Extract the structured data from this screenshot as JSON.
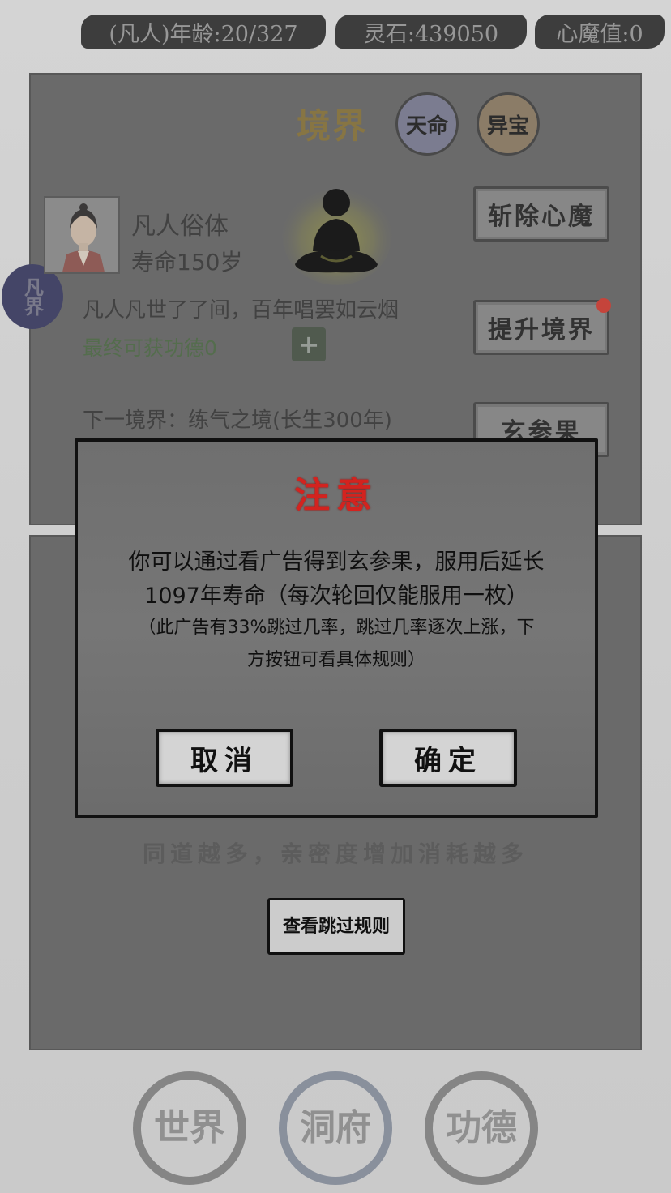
{
  "status_bar": {
    "age": "(凡人)年龄:20/327",
    "spirit_stones": "灵石:439050",
    "heart_demon": "心魔值:0"
  },
  "realm_panel": {
    "title": "境界",
    "fate_label": "天命",
    "treasure_label": "异宝",
    "side_badge": "凡界",
    "body_type": "凡人俗体",
    "lifespan": "寿命150岁",
    "motto": "凡人凡世了了间，百年唱罢如云烟",
    "merit": "最终可获功德0",
    "plus_label": "+",
    "next_realm": "下一境界：练气之境(长生300年)",
    "buttons": {
      "slay_demon": "斩除心魔",
      "upgrade_realm": "提升境界",
      "xuanshen_fruit": "玄参果"
    }
  },
  "modal": {
    "title": "注意",
    "body_line1": "你可以通过看广告得到玄参果，服用后延长",
    "body_line2": "1097年寿命（每次轮回仅能服用一枚）",
    "note_line1": "（此广告有33%跳过几率，跳过几率逐次上涨，下",
    "note_line2": "方按钮可看具体规则）",
    "cancel_label": "取消",
    "confirm_label": "确定"
  },
  "companion_hint": "同道越多，亲密度增加消耗越多",
  "rule_button": "查看跳过规则",
  "bottom_nav": {
    "world": "世界",
    "cave": "洞府",
    "merit": "功德"
  },
  "colors": {
    "modal_title": "#d3231f",
    "merit_text": "#56704f",
    "realm_title": "#8a7845",
    "notification_dot": "#c9463d"
  }
}
